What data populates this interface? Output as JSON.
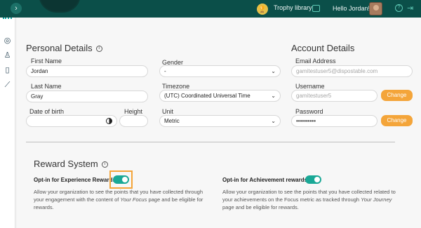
{
  "topbar": {
    "collapse_glyph": "›",
    "trophy_label": "Trophy library",
    "greeting": "Hello Jordan!"
  },
  "personal": {
    "title": "Personal Details",
    "first_name_label": "First Name",
    "first_name_value": "Jordan",
    "last_name_label": "Last Name",
    "last_name_value": "Gray",
    "dob_label": "Date of birth",
    "dob_value": "",
    "height_label": "Height",
    "height_value": "",
    "gender_label": "Gender",
    "gender_value": "-",
    "timezone_label": "Timezone",
    "timezone_value": "(UTC) Coordinated Universal Time",
    "unit_label": "Unit",
    "unit_value": "Metric"
  },
  "account": {
    "title": "Account Details",
    "email_label": "Email Address",
    "email_placeholder": "gamitestuser5@dispostable.com",
    "username_label": "Username",
    "username_placeholder": "gamitestuser5",
    "password_label": "Password",
    "password_value": "••••••••••",
    "change_label": "Change"
  },
  "reward": {
    "title": "Reward System",
    "experience_label": "Opt-in for Experience Rewards",
    "experience_enabled": true,
    "experience_desc_1": "Allow your organization to see the points that you have collected through",
    "experience_desc_2a": "your engagement with the content of ",
    "experience_desc_2b": "Your Focus",
    "experience_desc_2c": " page and be eligible for",
    "experience_desc_3": "rewards.",
    "achievement_label": "Opt-in for Achievement rewards",
    "achievement_enabled": true,
    "achievement_desc_1": "Allow your organization to see the points that you have collected related to",
    "achievement_desc_2a": "your achievements on the Focus metric as tracked through ",
    "achievement_desc_2b": "Your Journey",
    "achievement_desc_3": "page and be eligible for rewards."
  },
  "icons": {
    "trophy": "trophy-icon",
    "messages": "message-icon",
    "help": "help-icon",
    "logout": "logout-icon",
    "side": [
      "target-icon",
      "profile-icon",
      "book-icon",
      "chart-icon"
    ]
  },
  "colors": {
    "topbar": "#0b4f49",
    "accent": "#1aa896",
    "button": "#f4a53a",
    "highlight": "#f4a53a"
  }
}
